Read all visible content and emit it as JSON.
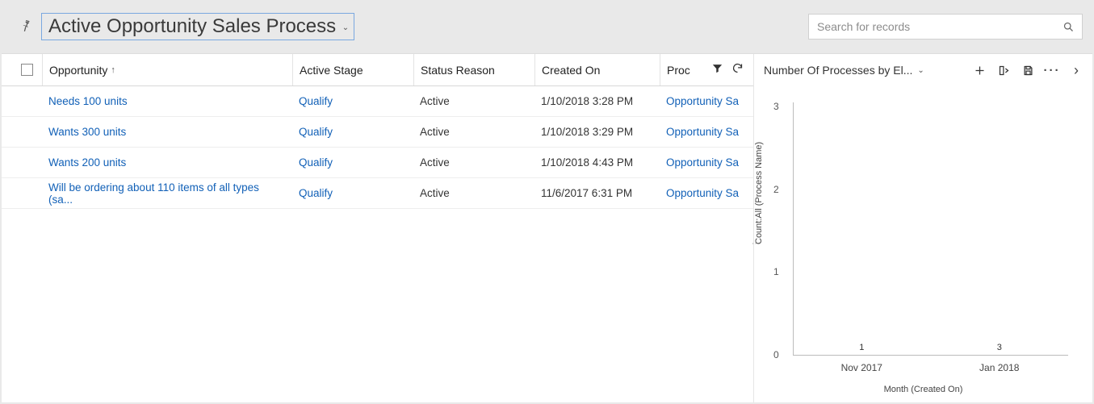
{
  "view": {
    "title": "Active Opportunity Sales Process"
  },
  "search": {
    "placeholder": "Search for records"
  },
  "grid": {
    "columns": {
      "opportunity": "Opportunity",
      "active_stage": "Active Stage",
      "status_reason": "Status Reason",
      "created_on": "Created On",
      "process": "Proc"
    },
    "sort_indicator": "↑",
    "rows": [
      {
        "opportunity": "Needs 100 units",
        "active_stage": "Qualify",
        "status_reason": "Active",
        "created_on": "1/10/2018 3:28 PM",
        "process": "Opportunity Sa"
      },
      {
        "opportunity": "Wants 300 units",
        "active_stage": "Qualify",
        "status_reason": "Active",
        "created_on": "1/10/2018 3:29 PM",
        "process": "Opportunity Sa"
      },
      {
        "opportunity": "Wants 200 units",
        "active_stage": "Qualify",
        "status_reason": "Active",
        "created_on": "1/10/2018 4:43 PM",
        "process": "Opportunity Sa"
      },
      {
        "opportunity": "Will be ordering about 110 items of all types (sa...",
        "active_stage": "Qualify",
        "status_reason": "Active",
        "created_on": "11/6/2017 6:31 PM",
        "process": "Opportunity Sa"
      }
    ]
  },
  "chart": {
    "title": "Number Of Processes by El..."
  },
  "chart_data": {
    "type": "bar",
    "title": "Number Of Processes by El...",
    "categories": [
      "Nov 2017",
      "Jan 2018"
    ],
    "values": [
      1,
      3
    ],
    "xlabel": "Month (Created On)",
    "ylabel": "Count:All (Process Name)",
    "ylim": [
      0,
      3
    ],
    "y_ticks": [
      3,
      2,
      1,
      0
    ]
  }
}
